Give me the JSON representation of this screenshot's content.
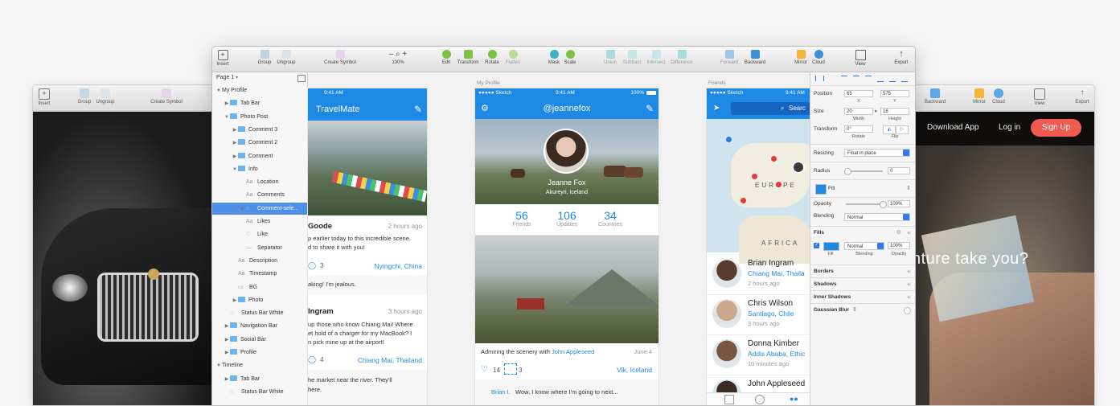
{
  "back_window": {
    "toolbar": [
      {
        "label": "Insert",
        "icon": "insert-icon"
      },
      {
        "label": "Group",
        "icon": "group-icon"
      },
      {
        "label": "Ungroup",
        "icon": "ungroup-icon"
      },
      {
        "label": "Create Symbol",
        "icon": "create-symbol-icon"
      },
      {
        "label": "Backward",
        "icon": "backward-icon"
      },
      {
        "label": "Mirror",
        "icon": "mirror-icon"
      },
      {
        "label": "Cloud",
        "icon": "cloud-icon"
      },
      {
        "label": "View",
        "icon": "view-icon"
      },
      {
        "label": "Export",
        "icon": "export-icon"
      }
    ],
    "website": {
      "download_label": "Download App",
      "login_label": "Log in",
      "signup_label": "Sign Up",
      "headline_fragment": "nture take you?"
    }
  },
  "front_window": {
    "toolbar": {
      "insert": "Insert",
      "group": "Group",
      "ungroup": "Ungroup",
      "create_symbol": "Create Symbol",
      "zoom_minus": "–",
      "zoom_plus": "+",
      "zoom": "100%",
      "edit": "Edit",
      "transform": "Transform",
      "rotate": "Rotate",
      "flatten": "Flatten",
      "mask": "Mask",
      "scale": "Scale",
      "union": "Union",
      "subtract": "Subtract",
      "intersect": "Intersect",
      "difference": "Difference",
      "forward": "Forward",
      "backward": "Backward",
      "mirror": "Mirror",
      "cloud": "Cloud",
      "view": "View",
      "export": "Export"
    },
    "layers": {
      "page": "Page 1",
      "rows": [
        {
          "label": "My Profile",
          "kind": "group",
          "indent": 0,
          "fold": "▼"
        },
        {
          "label": "Tab Bar",
          "kind": "folder",
          "indent": 1,
          "fold": "▶"
        },
        {
          "label": "Photo Post",
          "kind": "folder",
          "indent": 1,
          "fold": "▼"
        },
        {
          "label": "Comment 3",
          "kind": "folder",
          "indent": 2,
          "fold": "▶"
        },
        {
          "label": "Comment 2",
          "kind": "folder",
          "indent": 2,
          "fold": "▶"
        },
        {
          "label": "Comment",
          "kind": "folder",
          "indent": 2,
          "fold": "▶"
        },
        {
          "label": "Info",
          "kind": "folder",
          "indent": 2,
          "fold": "▼"
        },
        {
          "label": "Location",
          "kind": "text",
          "indent": 3,
          "fold": "",
          "glyph": "Aa"
        },
        {
          "label": "Comments",
          "kind": "text",
          "indent": 3,
          "fold": "",
          "glyph": "Aa"
        },
        {
          "label": "Comment-sele...",
          "kind": "symbol",
          "indent": 3,
          "fold": "▶",
          "glyph": "◌",
          "selected": true
        },
        {
          "label": "Likes",
          "kind": "text",
          "indent": 3,
          "fold": "",
          "glyph": "Aa"
        },
        {
          "label": "Like",
          "kind": "shape",
          "indent": 3,
          "fold": "",
          "glyph": "♡"
        },
        {
          "label": "Separator",
          "kind": "line",
          "indent": 3,
          "fold": "",
          "glyph": "—"
        },
        {
          "label": "Description",
          "kind": "text",
          "indent": 2,
          "fold": "",
          "glyph": "Aa"
        },
        {
          "label": "Timestamp",
          "kind": "text",
          "indent": 2,
          "fold": "",
          "glyph": "Aa"
        },
        {
          "label": "BG",
          "kind": "shape",
          "indent": 2,
          "fold": "",
          "glyph": "▭"
        },
        {
          "label": "Photo",
          "kind": "folder",
          "indent": 2,
          "fold": "▶"
        },
        {
          "label": "Status Bar White",
          "kind": "symbol",
          "indent": 1,
          "fold": "",
          "glyph": "◌"
        },
        {
          "label": "Navigation Bar",
          "kind": "folder",
          "indent": 1,
          "fold": "▶"
        },
        {
          "label": "Social Bar",
          "kind": "folder",
          "indent": 1,
          "fold": "▶"
        },
        {
          "label": "Profile",
          "kind": "folder",
          "indent": 1,
          "fold": "▶"
        },
        {
          "label": "Timeline",
          "kind": "group",
          "indent": 0,
          "fold": "▼"
        },
        {
          "label": "Tab Bar",
          "kind": "folder",
          "indent": 1,
          "fold": "▶"
        },
        {
          "label": "Status Bar White",
          "kind": "symbol",
          "indent": 1,
          "fold": "",
          "glyph": "◌"
        }
      ]
    },
    "artboard_labels": {
      "profile": "My Profile",
      "friends": "Friends"
    },
    "travelmate": {
      "time": "9:41 AM",
      "title": "TravelMate",
      "post1": {
        "name": "Goode",
        "time": "2 hours ago",
        "text1": "p earlier today to this incredible scene.",
        "text2": "d to share it with you!",
        "comments": "3",
        "location": "Nyingchi, China",
        "reply": "aking! I'm jealous."
      },
      "post2": {
        "name": "Ingram",
        "time": "3 hours ago",
        "text1": "up those who know Chiang Mai! Where",
        "text2": "et hold of a charger for my MacBook? I",
        "text3": "n pick mine up at the airport!",
        "comments": "4",
        "location": "Chiang Mai, Thailand",
        "reply1": "he market near the river. They'll",
        "reply2": "here."
      }
    },
    "profile": {
      "carrier": "●●●●● Sketch",
      "time": "9:41 AM",
      "battery": "100%",
      "username": "@jeannefox",
      "name": "Jeanne Fox",
      "place": "Akureyri, Iceland",
      "stats": [
        {
          "num": "56",
          "label": "Friends"
        },
        {
          "num": "106",
          "label": "Updates"
        },
        {
          "num": "34",
          "label": "Countries"
        }
      ],
      "caption_prefix": "Admiring the scenery with",
      "caption_link": "John Appleseed",
      "caption_date": "June 4",
      "likes": "14",
      "comments": "3",
      "location": "Vik, Iceland",
      "comment_author": "Brian I.",
      "comment_text": "Wow, I know where I'm going to next..."
    },
    "friends": {
      "carrier": "●●●●● Sketch",
      "time": "9:41 AM",
      "search": "Searc",
      "map_label_europe": "EUROPE",
      "map_label_africa": "AFRICA",
      "list": [
        {
          "name": "Brian Ingram",
          "location": "Chiang Mai, Thaila",
          "time": "2 hours ago"
        },
        {
          "name": "Chris Wilson",
          "location": "Santiago, Chile",
          "time": "3 hours ago"
        },
        {
          "name": "Donna Kimber",
          "location": "Addis Ababa, Ethic",
          "time": "10 minutes ago"
        },
        {
          "name": "John Appleseed",
          "location": "",
          "time": ""
        }
      ]
    },
    "inspector": {
      "position_label": "Position",
      "x": "65",
      "y": "575",
      "x_lbl": "X",
      "y_lbl": "Y",
      "size_label": "Size",
      "width": "20",
      "height": "18",
      "width_lbl": "Width",
      "height_lbl": "Height",
      "transform_label": "Transform",
      "rotate": "0°",
      "rotate_lbl": "Rotate",
      "flip_lbl": "Flip",
      "resizing_label": "Resizing",
      "resizing_value": "Float in place",
      "radius_label": "Radius",
      "radius_value": "0",
      "fill_style": "Fill",
      "opacity_label": "Opacity",
      "opacity_value": "100%",
      "blending_label": "Blending",
      "blending_value": "Normal",
      "fills_label": "Fills",
      "fill_blend": "Normal",
      "fill_opacity": "100%",
      "fill_lbl": "Fill",
      "blend_lbl": "Blending",
      "opacity_lbl": "Opacity",
      "borders": "Borders",
      "shadows": "Shadows",
      "inner_shadows": "Inner Shadows",
      "gaussian_blur": "Gaussian Blur",
      "accent": "#1e88e5"
    }
  }
}
